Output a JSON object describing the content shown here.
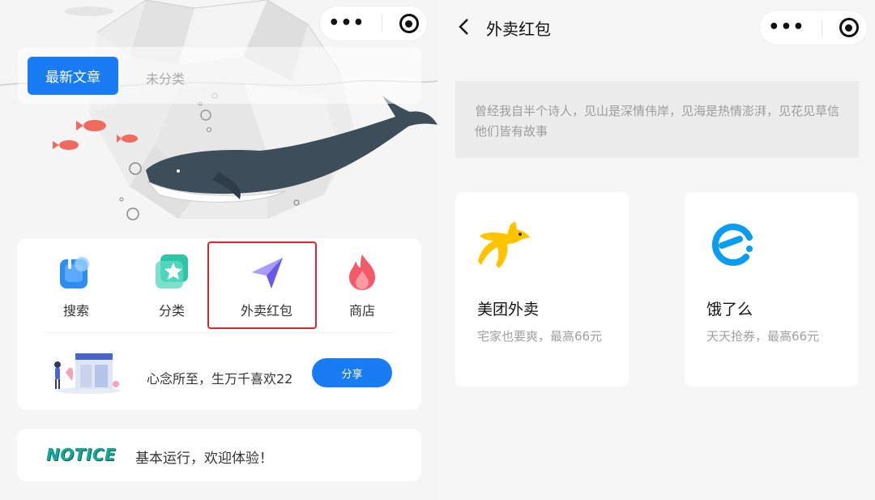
{
  "left": {
    "tabs": {
      "active": "最新文章",
      "inactive": "未分类"
    },
    "menu": [
      {
        "label": "搜索",
        "icon": "search-icon"
      },
      {
        "label": "分类",
        "icon": "category-star-icon"
      },
      {
        "label": "外卖红包",
        "icon": "send-arrow-icon"
      },
      {
        "label": "商店",
        "icon": "flame-icon"
      }
    ],
    "share": {
      "text": "心念所至，生万千喜欢22",
      "button": "分享"
    },
    "notice": {
      "logo": "NOTICE",
      "text": "基本运行，欢迎体验！"
    }
  },
  "right": {
    "nav_title": "外卖红包",
    "intro": "曾经我自半个诗人，见山是深情伟岸，见海是热情澎湃，见花见草信他们皆有故事",
    "cards": [
      {
        "name": "美团外卖",
        "desc": "宅家也要爽，最高66元",
        "icon": "meituan-kangaroo-icon"
      },
      {
        "name": "饿了么",
        "desc": "天天抢券，最高66元",
        "icon": "eleme-logo-icon"
      }
    ]
  },
  "colors": {
    "accent": "#1a7cf5",
    "highlight": "#d9272e",
    "meituan": "#ffc300",
    "eleme": "#0a9cf0",
    "notice": "#14a89a"
  }
}
